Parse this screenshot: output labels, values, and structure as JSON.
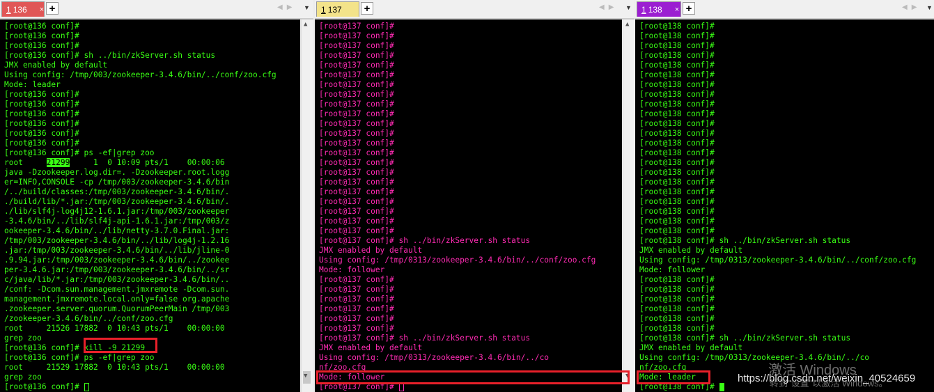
{
  "panes": [
    {
      "tab_num": "1",
      "tab_label": "136",
      "tab_bg": "#e05757",
      "color": "#39ff14",
      "lines": [
        "[root@136 conf]#",
        "[root@136 conf]#",
        "[root@136 conf]#",
        "[root@136 conf]# sh ../bin/zkServer.sh status",
        "JMX enabled by default",
        "Using config: /tmp/003/zookeeper-3.4.6/bin/../conf/zoo.cfg",
        "Mode: leader",
        "[root@136 conf]#",
        "[root@136 conf]#",
        "[root@136 conf]#",
        "[root@136 conf]#",
        "[root@136 conf]#",
        "[root@136 conf]#",
        "[root@136 conf]# ps -ef|grep zoo",
        "root     21299     1  0 10:09 pts/1    00:00:06",
        "java -Dzookeeper.log.dir=. -Dzookeeper.root.logg",
        "er=INFO,CONSOLE -cp /tmp/003/zookeeper-3.4.6/bin",
        "/../build/classes:/tmp/003/zookeeper-3.4.6/bin/.",
        "./build/lib/*.jar:/tmp/003/zookeeper-3.4.6/bin/.",
        "./lib/slf4j-log4j12-1.6.1.jar:/tmp/003/zookeeper",
        "-3.4.6/bin/../lib/slf4j-api-1.6.1.jar:/tmp/003/z",
        "ookeeper-3.4.6/bin/../lib/netty-3.7.0.Final.jar:",
        "/tmp/003/zookeeper-3.4.6/bin/../lib/log4j-1.2.16",
        ".jar:/tmp/003/zookeeper-3.4.6/bin/../lib/jline-0",
        ".9.94.jar:/tmp/003/zookeeper-3.4.6/bin/../zookee",
        "per-3.4.6.jar:/tmp/003/zookeeper-3.4.6/bin/../sr",
        "c/java/lib/*.jar:/tmp/003/zookeeper-3.4.6/bin/..",
        "/conf: -Dcom.sun.management.jmxremote -Dcom.sun.",
        "management.jmxremote.local.only=false org.apache",
        ".zookeeper.server.quorum.QuorumPeerMain /tmp/003",
        "/zookeeper-3.4.6/bin/../conf/zoo.cfg",
        "root     21526 17882  0 10:43 pts/1    00:00:00",
        "grep zoo",
        "[root@136 conf]# kill -9 21299",
        "[root@136 conf]# ps -ef|grep zoo",
        "root     21529 17882  0 10:43 pts/1    00:00:00",
        "grep zoo",
        "[root@136 conf]# "
      ],
      "highlight_pid": "21299"
    },
    {
      "tab_num": "1",
      "tab_label": "137",
      "tab_bg": "#f3e38a",
      "color": "#ff2bb3",
      "lines": [
        "[root@137 conf]#",
        "[root@137 conf]#",
        "[root@137 conf]#",
        "[root@137 conf]#",
        "[root@137 conf]#",
        "[root@137 conf]#",
        "[root@137 conf]#",
        "[root@137 conf]#",
        "[root@137 conf]#",
        "[root@137 conf]#",
        "[root@137 conf]#",
        "[root@137 conf]#",
        "[root@137 conf]#",
        "[root@137 conf]#",
        "[root@137 conf]#",
        "[root@137 conf]#",
        "[root@137 conf]#",
        "[root@137 conf]#",
        "[root@137 conf]#",
        "[root@137 conf]#",
        "[root@137 conf]#",
        "[root@137 conf]#",
        "[root@137 conf]# sh ../bin/zkServer.sh status",
        "JMX enabled by default",
        "Using config: /tmp/0313/zookeeper-3.4.6/bin/../conf/zoo.cfg",
        "Mode: follower",
        "[root@137 conf]#",
        "[root@137 conf]#",
        "[root@137 conf]#",
        "[root@137 conf]#",
        "[root@137 conf]#",
        "[root@137 conf]#",
        "[root@137 conf]# sh ../bin/zkServer.sh status",
        "JMX enabled by default",
        "Using config: /tmp/0313/zookeeper-3.4.6/bin/../co",
        "nf/zoo.cfg",
        "Mode: follower",
        "[root@137 conf]# "
      ]
    },
    {
      "tab_num": "1",
      "tab_label": "138",
      "tab_bg": "#9b1fd1",
      "color": "#39ff14",
      "lines": [
        "[root@138 conf]#",
        "[root@138 conf]#",
        "[root@138 conf]#",
        "[root@138 conf]#",
        "[root@138 conf]#",
        "[root@138 conf]#",
        "[root@138 conf]#",
        "[root@138 conf]#",
        "[root@138 conf]#",
        "[root@138 conf]#",
        "[root@138 conf]#",
        "[root@138 conf]#",
        "[root@138 conf]#",
        "[root@138 conf]#",
        "[root@138 conf]#",
        "[root@138 conf]#",
        "[root@138 conf]#",
        "[root@138 conf]#",
        "[root@138 conf]#",
        "[root@138 conf]#",
        "[root@138 conf]#",
        "[root@138 conf]#",
        "[root@138 conf]# sh ../bin/zkServer.sh status",
        "JMX enabled by default",
        "Using config: /tmp/0313/zookeeper-3.4.6/bin/../conf/zoo.cfg",
        "Mode: follower",
        "[root@138 conf]#",
        "[root@138 conf]#",
        "[root@138 conf]#",
        "[root@138 conf]#",
        "[root@138 conf]#",
        "[root@138 conf]#",
        "[root@138 conf]# sh ../bin/zkServer.sh status",
        "JMX enabled by default",
        "Using config: /tmp/0313/zookeeper-3.4.6/bin/../co",
        "nf/zoo.cfg",
        "Mode: leader",
        "[root@138 conf]# "
      ]
    }
  ],
  "tab_close_glyph": "×",
  "add_tab_glyph": "+",
  "watermark": {
    "line1": "激活 Windows",
    "line2": "转到\"设置\"以激活 Windows。",
    "url": "https://blog.csdn.net/weixin_40524659"
  }
}
